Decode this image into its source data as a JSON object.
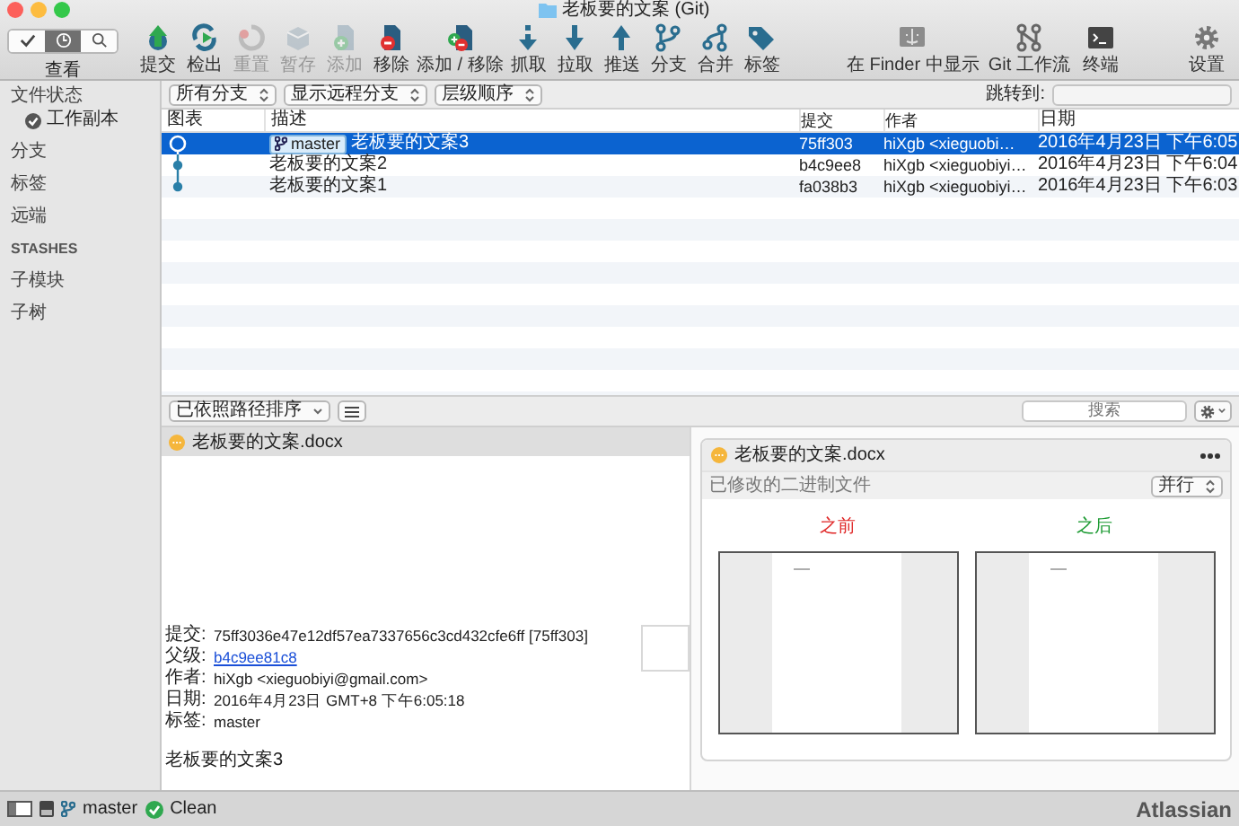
{
  "window": {
    "title": "老板要的文案 (Git)"
  },
  "view_switch": {
    "label": "查看",
    "segments": [
      {
        "selected": false
      },
      {
        "selected": true
      },
      {
        "selected": false
      }
    ]
  },
  "toolbar": {
    "main": [
      {
        "label": "提交",
        "disabled": false
      },
      {
        "label": "检出",
        "disabled": false
      },
      {
        "label": "重置",
        "disabled": true
      },
      {
        "label": "暂存",
        "disabled": true
      },
      {
        "label": "添加",
        "disabled": true
      },
      {
        "label": "移除",
        "disabled": false
      },
      {
        "label": "添加 / 移除",
        "disabled": false
      },
      {
        "label": "抓取",
        "disabled": false
      },
      {
        "label": "拉取",
        "disabled": false
      },
      {
        "label": "推送",
        "disabled": false
      },
      {
        "label": "分支",
        "disabled": false
      },
      {
        "label": "合并",
        "disabled": false
      },
      {
        "label": "标签",
        "disabled": false
      }
    ],
    "tools": [
      {
        "label": "在 Finder 中显示"
      },
      {
        "label": "Git 工作流"
      },
      {
        "label": "终端"
      }
    ],
    "settings": {
      "label": "设置"
    }
  },
  "sidebar": [
    {
      "label": "文件状态",
      "kind": "item",
      "children": [
        {
          "label": "工作副本"
        }
      ]
    },
    {
      "label": "分支",
      "kind": "item"
    },
    {
      "label": "标签",
      "kind": "item"
    },
    {
      "label": "远端",
      "kind": "item"
    },
    {
      "label": "STASHES",
      "kind": "header"
    },
    {
      "label": "子模块",
      "kind": "item"
    },
    {
      "label": "子树",
      "kind": "item"
    }
  ],
  "filters": [
    {
      "value": "所有分支"
    },
    {
      "value": "显示远程分支"
    },
    {
      "value": "层级顺序"
    }
  ],
  "jump_to": {
    "label": "跳转到:"
  },
  "table": {
    "columns": [
      "图表",
      "描述",
      "提交",
      "作者",
      "日期"
    ],
    "rows": [
      {
        "branch": "master",
        "description": "老板要的文案3",
        "commit": "75ff303",
        "author": "hiXgb <xieguobi…",
        "date": "2016年4月23日 下午6:05",
        "selected": true
      },
      {
        "description": "老板要的文案2",
        "commit": "b4c9ee8",
        "author": "hiXgb <xieguobiyi…",
        "date": "2016年4月23日 下午6:04",
        "selected": false
      },
      {
        "description": "老板要的文案1",
        "commit": "fa038b3",
        "author": "hiXgb <xieguobiyi…",
        "date": "2016年4月23日 下午6:03",
        "selected": false
      }
    ]
  },
  "file_toolbar": {
    "sort": "已依照路径排序",
    "search_placeholder": "搜索"
  },
  "files": [
    {
      "name": "老板要的文案.docx",
      "selected": true
    }
  ],
  "details": {
    "fields": [
      {
        "label": "提交:",
        "value": "75ff3036e47e12df57ea7337656c3cd432cfe6ff [75ff303]",
        "kind": "text"
      },
      {
        "label": "父级:",
        "value": "b4c9ee81c8",
        "kind": "link"
      },
      {
        "label": "作者:",
        "value": "hiXgb <xieguobiyi@gmail.com>",
        "kind": "text"
      },
      {
        "label": "日期:",
        "value": "2016年4月23日 GMT+8 下午6:05:18",
        "kind": "text"
      },
      {
        "label": "标签:",
        "value": "master",
        "kind": "text"
      }
    ],
    "message": "老板要的文案3"
  },
  "diff": {
    "file": "老板要的文案.docx",
    "subtitle": "已修改的二进制文件",
    "mode": "并行",
    "before": "之前",
    "after": "之后"
  },
  "status_bar": {
    "branch": "master",
    "state": "Clean",
    "brand": "Atlassian"
  }
}
